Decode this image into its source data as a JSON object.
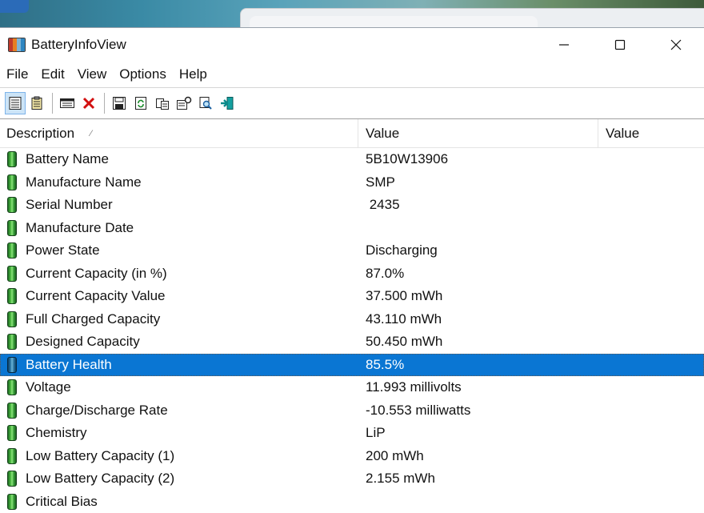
{
  "window": {
    "title": "BatteryInfoView",
    "minimize_symbol": "─",
    "maximize_symbol": "☐",
    "close_symbol": "✕"
  },
  "menu": [
    "File",
    "Edit",
    "View",
    "Options",
    "Help"
  ],
  "toolbar": {
    "icons": [
      "details-view-icon",
      "summary-view-icon",
      "columns-icon",
      "delete-icon",
      "save-icon",
      "refresh-icon",
      "copy-icon",
      "properties-icon",
      "find-icon",
      "exit-icon"
    ]
  },
  "columns": {
    "description": "Description",
    "value": "Value",
    "value2": "Value"
  },
  "rows": [
    {
      "desc": "Battery Name",
      "value": "5B10W13906"
    },
    {
      "desc": "Manufacture Name",
      "value": "SMP"
    },
    {
      "desc": "Serial Number",
      "value": " 2435"
    },
    {
      "desc": "Manufacture Date",
      "value": ""
    },
    {
      "desc": "Power State",
      "value": "Discharging"
    },
    {
      "desc": "Current Capacity (in %)",
      "value": "87.0%"
    },
    {
      "desc": "Current Capacity Value",
      "value": "37.500 mWh"
    },
    {
      "desc": "Full Charged Capacity",
      "value": "43.110 mWh"
    },
    {
      "desc": "Designed Capacity",
      "value": "50.450 mWh"
    },
    {
      "desc": "Battery Health",
      "value": "85.5%",
      "selected": true
    },
    {
      "desc": "Voltage",
      "value": "11.993 millivolts"
    },
    {
      "desc": "Charge/Discharge Rate",
      "value": "-10.553 milliwatts"
    },
    {
      "desc": "Chemistry",
      "value": "LiP"
    },
    {
      "desc": "Low Battery Capacity (1)",
      "value": "200 mWh"
    },
    {
      "desc": "Low Battery Capacity (2)",
      "value": "2.155 mWh"
    },
    {
      "desc": "Critical Bias",
      "value": ""
    }
  ],
  "colors": {
    "selection": "#0a76d3",
    "battery_green": "#4fbf44"
  }
}
